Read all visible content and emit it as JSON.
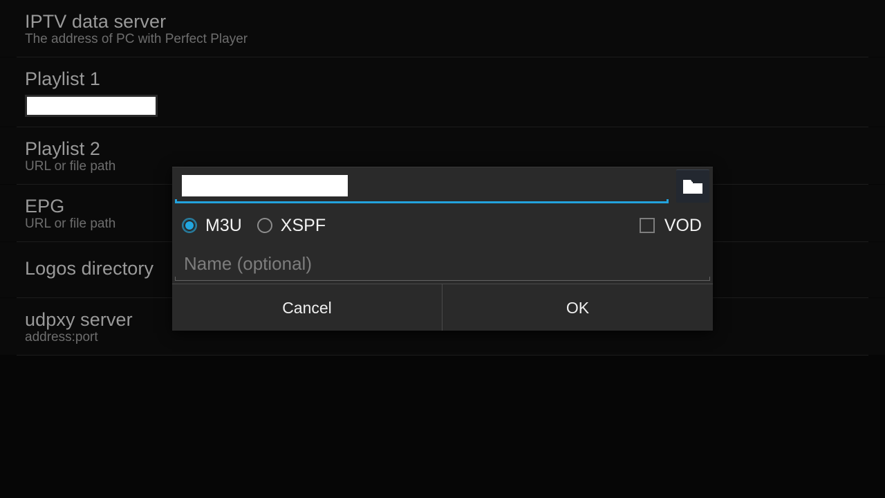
{
  "settings": {
    "rows": [
      {
        "title": "IPTV data server",
        "summary": "The address of PC with Perfect Player",
        "field": false
      },
      {
        "title": "Playlist 1",
        "summary": "",
        "field": true
      },
      {
        "title": "Playlist 2",
        "summary": "URL or file path",
        "field": false
      },
      {
        "title": "EPG",
        "summary": "URL or file path",
        "field": false
      },
      {
        "title": "Logos directory",
        "summary": "",
        "field": false
      },
      {
        "title": "udpxy server",
        "summary": "address:port",
        "field": false
      }
    ]
  },
  "dialog": {
    "url_input": {
      "value": "",
      "placeholder": ""
    },
    "browse_icon": "folder-icon",
    "format_options": [
      {
        "label": "M3U",
        "selected": true
      },
      {
        "label": "XSPF",
        "selected": false
      }
    ],
    "vod": {
      "label": "VOD",
      "checked": false
    },
    "name_input": {
      "value": "",
      "placeholder": "Name (optional)"
    },
    "buttons": {
      "cancel": "Cancel",
      "ok": "OK"
    }
  },
  "colors": {
    "accent": "#22a7e0",
    "dialog_bg": "#2a2a2a",
    "page_bg": "#060606"
  }
}
